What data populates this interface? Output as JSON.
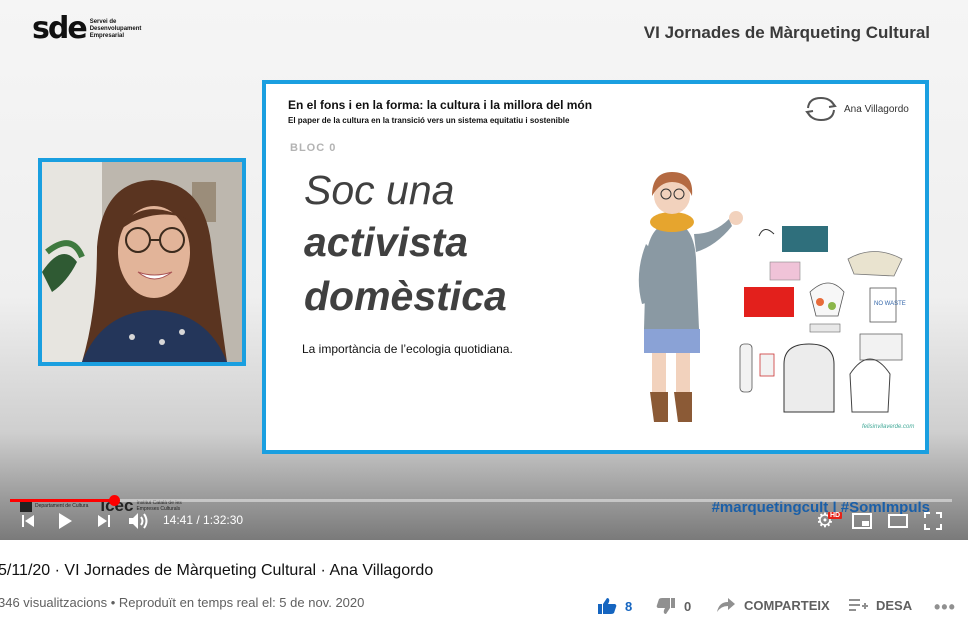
{
  "player": {
    "brand_logo": "sde",
    "brand_sub_1": "Servei de",
    "brand_sub_2": "Desenvolupament",
    "brand_sub_3": "Empresarial",
    "event_title": "VI Jornades de Màrqueting Cultural",
    "hashtag": "#marquetingcult | #SomImpuls",
    "progress_fraction": 0.11,
    "time": "14:41 / 1:32:30",
    "partner_1": "Departament de Cultura",
    "partner_2": "Institut Català de les Empreses Culturals",
    "hd_badge": "HD"
  },
  "slide": {
    "title": "En el fons i en la forma: la cultura i la millora del món",
    "subtitle": "El paper de la cultura en la transició vers un sistema equitatiu i sostenible",
    "author": "Ana Villagordo",
    "bloc": "BLOC 0",
    "headline_1": "Soc una",
    "headline_2": "activista",
    "headline_3": "domèstica",
    "lead": "La importància de l’ecologia quotidiana.",
    "credit": "felisinvilaverde.com",
    "sign_text": "NO WASTE"
  },
  "video": {
    "title": "5/11/20 · VI Jornades de Màrqueting Cultural · Ana Villagordo",
    "meta": "346 visualitzacions • Reproduït en temps real el: 5 de nov. 2020",
    "likes": "8",
    "dislikes": "0",
    "share_label": "COMPARTEIX",
    "save_label": "DESA"
  },
  "colors": {
    "accent": "#1a9fe0",
    "progress": "#ff0000",
    "hashtag": "#1a5fa8"
  }
}
